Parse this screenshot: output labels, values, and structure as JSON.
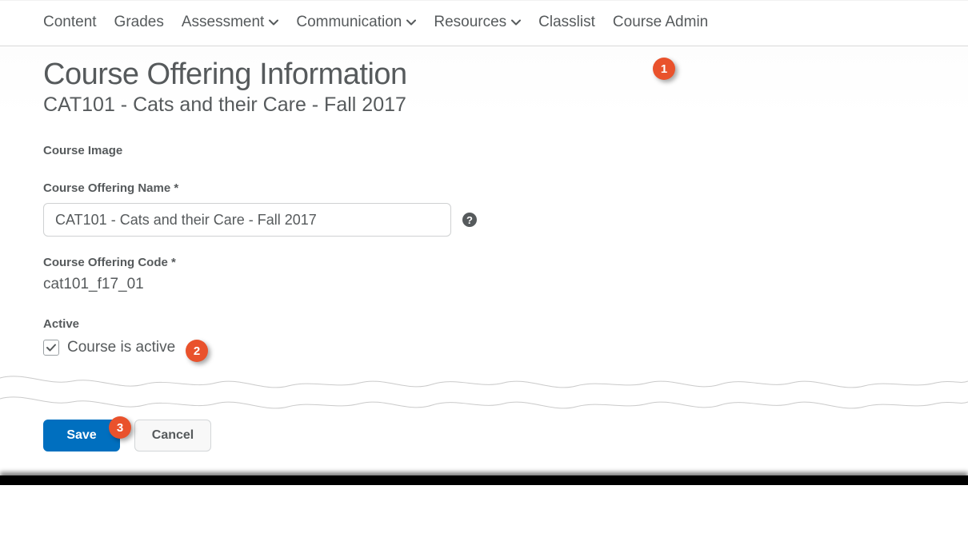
{
  "nav": {
    "items": [
      {
        "label": "Content",
        "has_menu": false
      },
      {
        "label": "Grades",
        "has_menu": false
      },
      {
        "label": "Assessment",
        "has_menu": true
      },
      {
        "label": "Communication",
        "has_menu": true
      },
      {
        "label": "Resources",
        "has_menu": true
      },
      {
        "label": "Classlist",
        "has_menu": false
      },
      {
        "label": "Course Admin",
        "has_menu": false
      }
    ]
  },
  "page": {
    "title": "Course Offering Information",
    "subtitle": "CAT101 - Cats and their Care - Fall 2017"
  },
  "form": {
    "course_image_label": "Course Image",
    "offering_name_label": "Course Offering Name *",
    "offering_name_value": "CAT101 - Cats and their Care - Fall 2017",
    "offering_code_label": "Course Offering Code *",
    "offering_code_value": "cat101_f17_01",
    "active_label": "Active",
    "active_checkbox_label": "Course is active",
    "active_checked": true
  },
  "actions": {
    "save_label": "Save",
    "cancel_label": "Cancel"
  },
  "callouts": {
    "c1": "1",
    "c2": "2",
    "c3": "3"
  },
  "colors": {
    "primary": "#006fbf",
    "callout": "#e9522c",
    "text": "#565a5c"
  }
}
